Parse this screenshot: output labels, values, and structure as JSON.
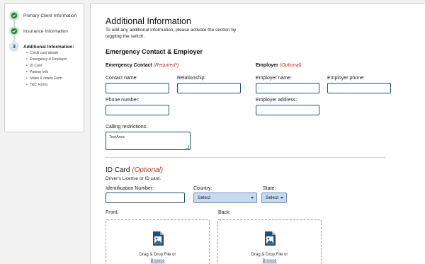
{
  "sidebar": {
    "steps": [
      {
        "label": "Primary Client Information",
        "status": "done"
      },
      {
        "label": "Insurance Information",
        "status": "done"
      },
      {
        "label": "Additional Information:",
        "status": "current",
        "number": "3"
      }
    ],
    "substeps": [
      "Credit card details",
      "Emergency & Employer",
      "ID Card",
      "Partner Info",
      "Notes & Intake Form",
      "T&C Forms"
    ]
  },
  "main": {
    "title": "Additional Information",
    "subtitle_line1": "To add any additional information, please activate the section by",
    "subtitle_line2": "toggling the switch.",
    "section_title": "Emergency Contact & Employer",
    "emergency": {
      "heading": "Emergency Contact",
      "required": "(Required*)",
      "contact_name_label": "Contact name:",
      "relationship_label": "Relationship:",
      "phone_label": "Phone number:",
      "calling_label": "Calling restrictions:",
      "calling_placeholder": "TextArea"
    },
    "employer": {
      "heading": "Employer",
      "optional": "(Optional)",
      "name_label": "Employer name:",
      "phone_label": "Employer phone:",
      "address_label": "Employer address:"
    },
    "id_card": {
      "heading": "ID Card",
      "optional": "(Optional)",
      "subtitle": "Driver's License or ID card.",
      "id_number_label": "Identification Number:",
      "country_label": "Country:",
      "country_value": "Select",
      "state_label": "State:",
      "state_value": "Select",
      "front_label": "Front:",
      "back_label": "Back:",
      "drop_text": "Drag & Drop File or",
      "browse_text": "Browse"
    }
  },
  "colors": {
    "accent_border": "#1f5268",
    "required": "#b23a2e",
    "step_done": "#2f7d44",
    "select_bg": "#c9daf0",
    "link": "#1f5ea8",
    "icon": "#1e4f7a"
  },
  "icons": [
    "check-icon",
    "image-file-icon",
    "chevron-down-icon"
  ]
}
